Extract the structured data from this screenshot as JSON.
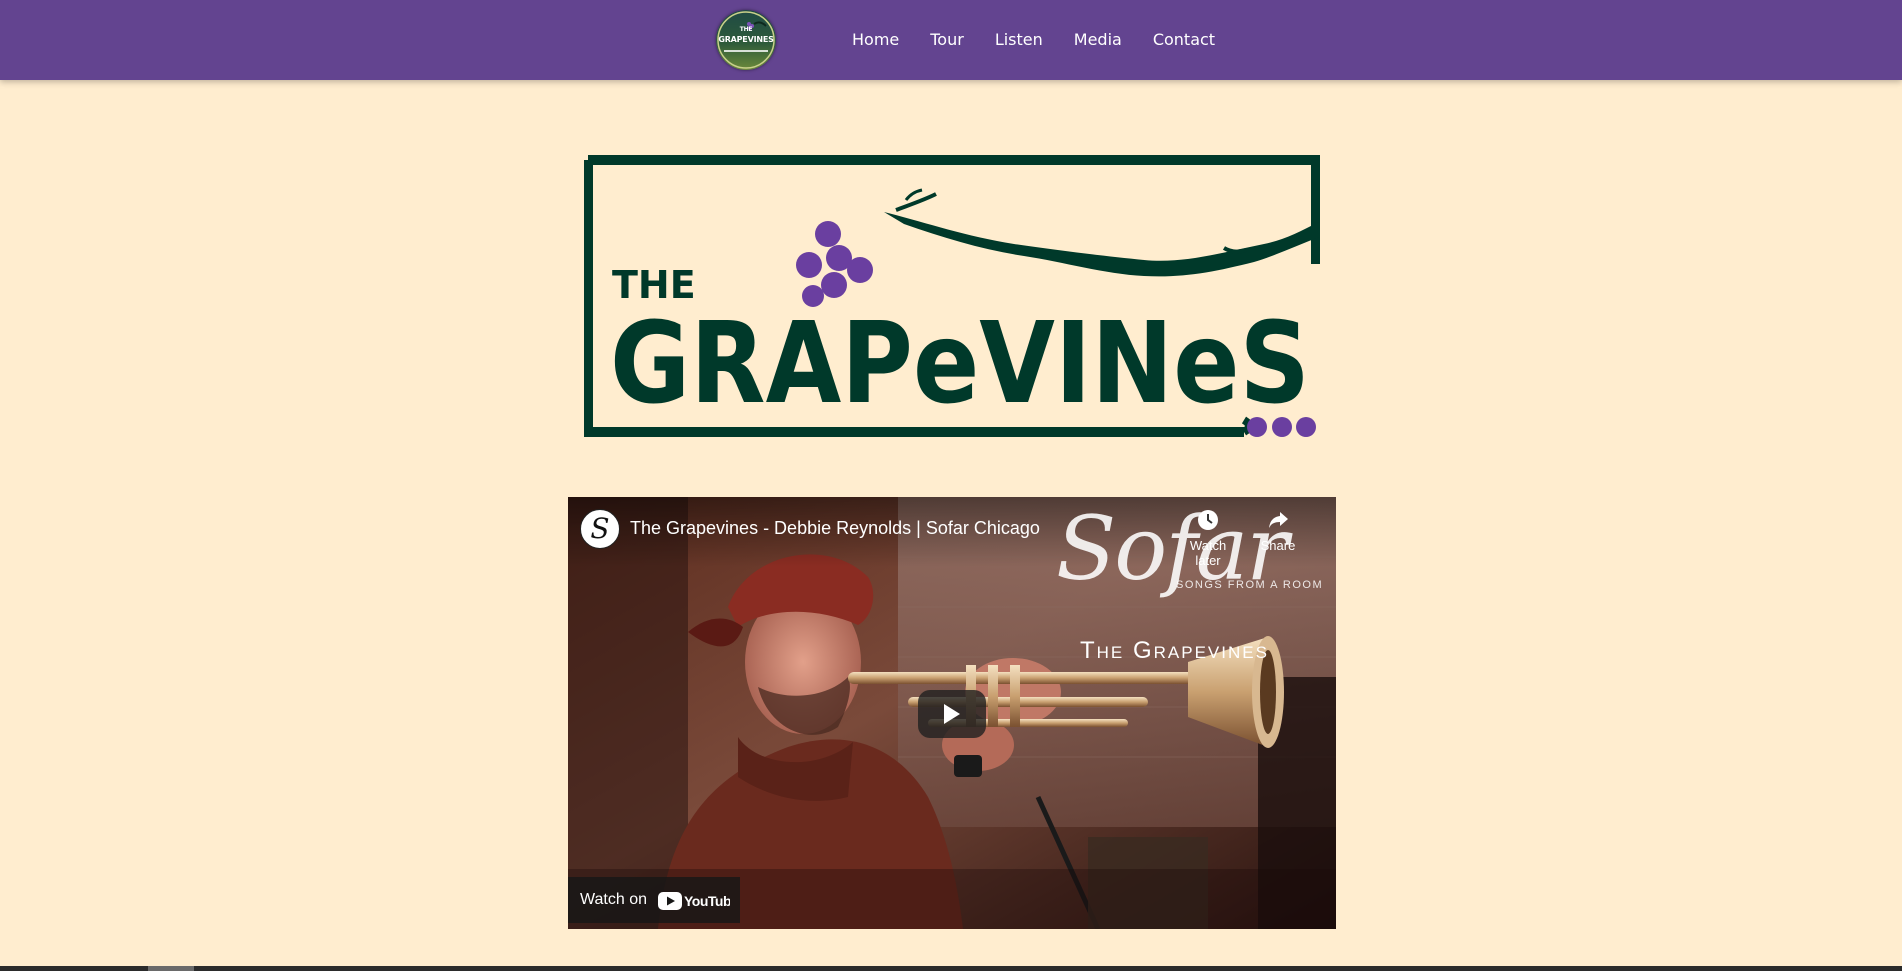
{
  "nav": {
    "logo_text": [
      "THE",
      "GRAPEVINES"
    ],
    "links": [
      "Home",
      "Tour",
      "Listen",
      "Media",
      "Contact"
    ]
  },
  "hero": {
    "logo_the": "THE",
    "logo_name": "GRAPeVINeS"
  },
  "video": {
    "channel_initial": "S",
    "title": "The Grapevines - Debbie Reynolds | Sofar Chicago",
    "watch_later_label": "Watch later",
    "share_label": "Share",
    "sofar_word": "Sofar",
    "sofar_sub": "SONGS FROM A ROOM",
    "band_name": "The Grapevines",
    "watch_on_label": "Watch on",
    "youtube_logo_text": "YouTube"
  },
  "colors": {
    "nav_bg": "#634490",
    "page_bg": "#ffedcf",
    "logo_green": "#00392a",
    "grape_purple": "#6a3fa0"
  }
}
